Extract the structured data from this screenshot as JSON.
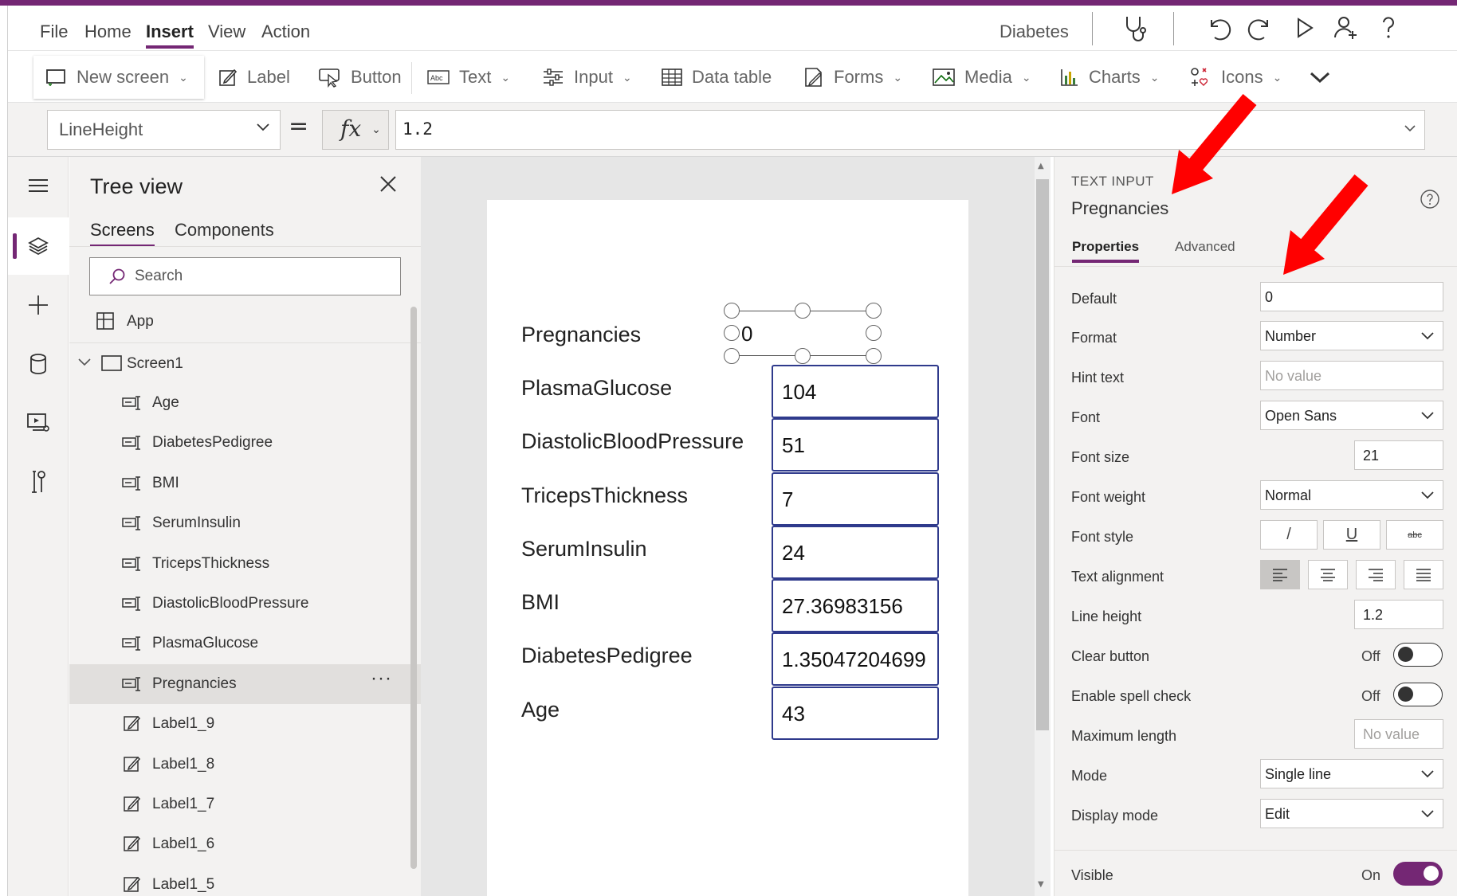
{
  "menu": {
    "items": [
      "File",
      "Home",
      "Insert",
      "View",
      "Action"
    ],
    "active": "Insert",
    "app_name": "Diabetes"
  },
  "ribbon": {
    "new_screen": "New screen",
    "label": "Label",
    "button": "Button",
    "text": "Text",
    "input": "Input",
    "data_table": "Data table",
    "forms": "Forms",
    "media": "Media",
    "charts": "Charts",
    "icons": "Icons"
  },
  "formula": {
    "property": "LineHeight",
    "equals": "=",
    "fx": "fx",
    "value": "1.2"
  },
  "tree": {
    "title": "Tree view",
    "tabs": [
      "Screens",
      "Components"
    ],
    "search_placeholder": "Search",
    "app_label": "App",
    "screen_label": "Screen1",
    "items": [
      {
        "label": "Age",
        "type": "textinput"
      },
      {
        "label": "DiabetesPedigree",
        "type": "textinput"
      },
      {
        "label": "BMI",
        "type": "textinput"
      },
      {
        "label": "SerumInsulin",
        "type": "textinput"
      },
      {
        "label": "TricepsThickness",
        "type": "textinput"
      },
      {
        "label": "DiastolicBloodPressure",
        "type": "textinput"
      },
      {
        "label": "PlasmaGlucose",
        "type": "textinput"
      },
      {
        "label": "Pregnancies",
        "type": "textinput",
        "selected": true
      },
      {
        "label": "Label1_9",
        "type": "label"
      },
      {
        "label": "Label1_8",
        "type": "label"
      },
      {
        "label": "Label1_7",
        "type": "label"
      },
      {
        "label": "Label1_6",
        "type": "label"
      },
      {
        "label": "Label1_5",
        "type": "label"
      }
    ],
    "more": "···"
  },
  "canvas": {
    "fields": [
      {
        "label": "Pregnancies",
        "value": "0"
      },
      {
        "label": "PlasmaGlucose",
        "value": "104"
      },
      {
        "label": "DiastolicBloodPressure",
        "value": "51"
      },
      {
        "label": "TricepsThickness",
        "value": "7"
      },
      {
        "label": "SerumInsulin",
        "value": "24"
      },
      {
        "label": "BMI",
        "value": "27.36983156"
      },
      {
        "label": "DiabetesPedigree",
        "value": "1.35047204699"
      },
      {
        "label": "Age",
        "value": "43"
      }
    ]
  },
  "props": {
    "type": "TEXT INPUT",
    "name": "Pregnancies",
    "tabs": [
      "Properties",
      "Advanced"
    ],
    "rows": {
      "default": {
        "label": "Default",
        "value": "0"
      },
      "format": {
        "label": "Format",
        "value": "Number"
      },
      "hint": {
        "label": "Hint text",
        "placeholder": "No value"
      },
      "font": {
        "label": "Font",
        "value": "Open Sans"
      },
      "font_size": {
        "label": "Font size",
        "value": "21"
      },
      "font_weight": {
        "label": "Font weight",
        "value": "Normal"
      },
      "font_style": {
        "label": "Font style",
        "italic": "/",
        "underline": "U",
        "strike": "abc"
      },
      "text_alignment": {
        "label": "Text alignment"
      },
      "line_height": {
        "label": "Line height",
        "value": "1.2"
      },
      "clear_button": {
        "label": "Clear button",
        "state": "Off"
      },
      "spell_check": {
        "label": "Enable spell check",
        "state": "Off"
      },
      "max_length": {
        "label": "Maximum length",
        "placeholder": "No value"
      },
      "mode": {
        "label": "Mode",
        "value": "Single line"
      },
      "display_mode": {
        "label": "Display mode",
        "value": "Edit"
      },
      "visible": {
        "label": "Visible",
        "state": "On"
      }
    }
  },
  "colors": {
    "accent": "#742774",
    "input_border": "#2f3a8c",
    "annotation_arrow": "#ff0000"
  }
}
